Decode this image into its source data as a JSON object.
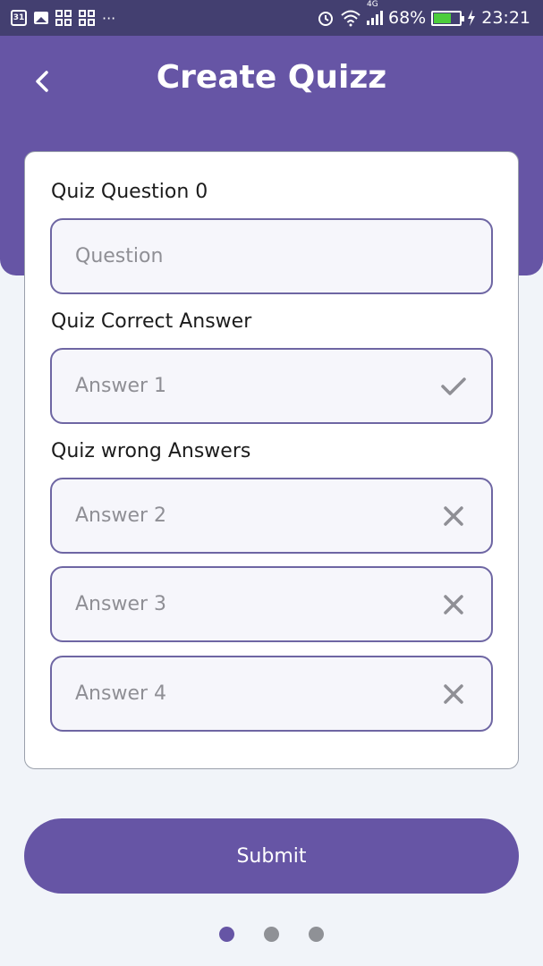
{
  "status_bar": {
    "calendar_day": "31",
    "more": "···",
    "network": "4G",
    "battery_percent": "68%",
    "battery_level": 0.68,
    "time": "23:21"
  },
  "header": {
    "title": "Create Quizz",
    "back_icon": "chevron-left-icon"
  },
  "form": {
    "question_label": "Quiz Question 0",
    "question_placeholder": "Question",
    "correct_label": "Quiz Correct Answer",
    "correct_placeholder": "Answer 1",
    "correct_icon": "check-icon",
    "wrong_label": "Quiz wrong Answers",
    "wrong_answers": [
      {
        "placeholder": "Answer 2",
        "icon": "close-icon"
      },
      {
        "placeholder": "Answer 3",
        "icon": "close-icon"
      },
      {
        "placeholder": "Answer 4",
        "icon": "close-icon"
      }
    ]
  },
  "submit_label": "Submit",
  "pager": {
    "count": 3,
    "active_index": 0
  },
  "colors": {
    "primary": "#6655a5",
    "status_bar": "#433f70",
    "background": "#f1f4f9",
    "field_border": "#6e66a3",
    "battery_fill": "#4ccd3c"
  }
}
